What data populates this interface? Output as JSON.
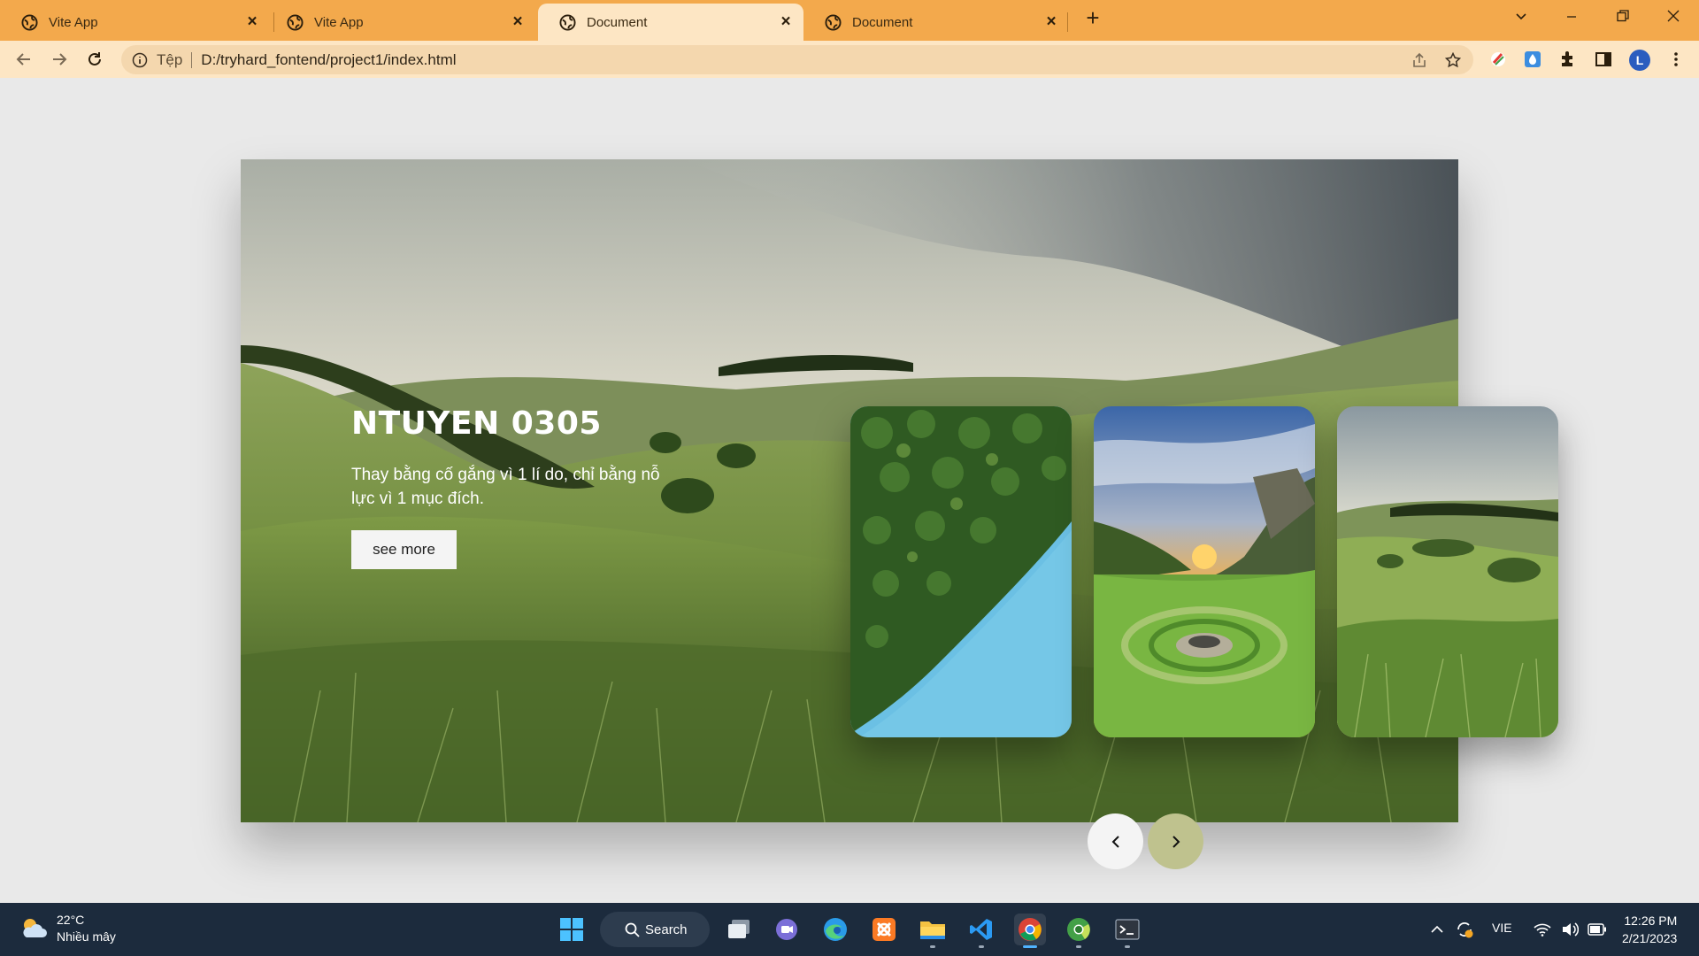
{
  "browser": {
    "tabs": [
      {
        "title": "Vite App",
        "active": false
      },
      {
        "title": "Vite App",
        "active": false
      },
      {
        "title": "Document",
        "active": true
      },
      {
        "title": "Document",
        "active": false
      }
    ],
    "address": {
      "scheme_label": "Tệp",
      "url": "D:/tryhard_fontend/project1/index.html"
    },
    "profile_initial": "L"
  },
  "hero": {
    "title": "NTUYEN 0305",
    "description": "Thay bằng cố gắng vì 1 lí do, chỉ bằng nỗ lực vì 1 mục đích.",
    "button_label": "see more",
    "cards": [
      {
        "name": "forest-lake-card"
      },
      {
        "name": "sunset-valley-card"
      },
      {
        "name": "green-hills-card"
      }
    ]
  },
  "taskbar": {
    "weather": {
      "temp": "22°C",
      "condition": "Nhiều mây"
    },
    "search_label": "Search",
    "language": "VIE",
    "time": "12:26 PM",
    "date": "2/21/2023"
  }
}
